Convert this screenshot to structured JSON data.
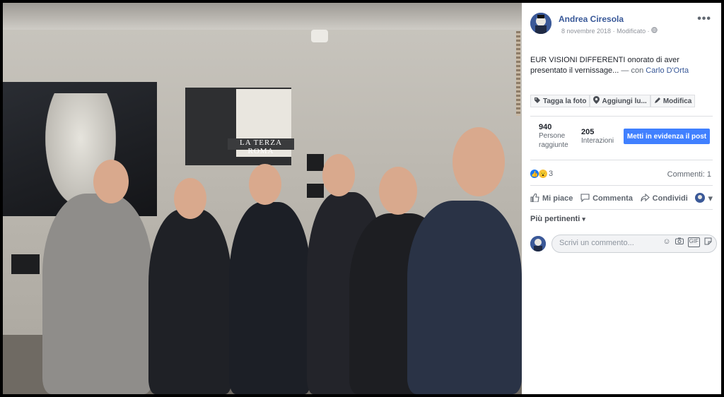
{
  "post": {
    "author": "Andrea Ciresola",
    "date": "8 novembre 2018",
    "edited": "Modificato",
    "text": "EUR VISIONI DIFFERENTI onorato di aver presentato il vernissage...",
    "with_prefix": "— con",
    "tagged": "Carlo D'Orta",
    "more_icon": "more-options-icon",
    "privacy_icon": "globe-icon"
  },
  "photo_actions": [
    {
      "label": "Tagga la foto",
      "icon": "tag-icon"
    },
    {
      "label": "Aggiungi lu...",
      "icon": "location-pin-icon"
    },
    {
      "label": "Modifica",
      "icon": "pencil-icon"
    }
  ],
  "insights": {
    "reached": {
      "value": "940",
      "label_line1": "Persone",
      "label_line2": "raggiunte"
    },
    "interactions": {
      "value": "205",
      "label": "Interazioni"
    },
    "boost_label": "Metti in evidenza il post",
    "boost_color": "#4080ff"
  },
  "reactions": {
    "count": "3",
    "comments": "Commenti: 1"
  },
  "actions": {
    "like": "Mi piace",
    "comment": "Commenta",
    "share": "Condividi"
  },
  "comments": {
    "sort_label": "Più pertinenti",
    "placeholder": "Scrivi un commento..."
  },
  "photo": {
    "caption_text": "LA TERZA ROMA"
  }
}
